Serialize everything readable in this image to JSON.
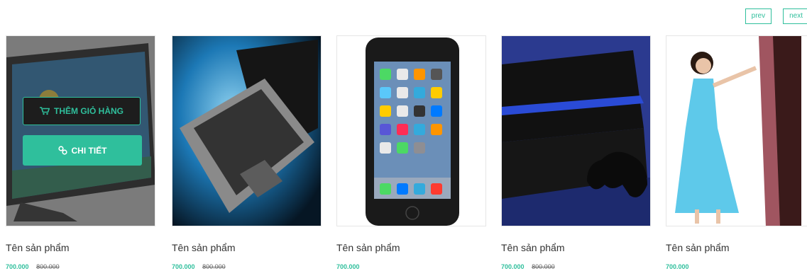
{
  "pagination": {
    "prev_label": "prev",
    "next_label": "next"
  },
  "colors": {
    "accent": "#2fbf9c",
    "text": "#333333",
    "old_price": "#666666"
  },
  "overlay": {
    "add_to_cart_label": "THÊM GIỎ HÀNG",
    "detail_label": "CHI TIẾT",
    "cart_icon": "cart-icon",
    "link_icon": "link-icon"
  },
  "products": [
    {
      "name": "Tên sản phẩm",
      "price": "700.000",
      "old_price": "800.000",
      "image": "tv"
    },
    {
      "name": "Tên sản phẩm",
      "price": "700.000",
      "old_price": "800.000",
      "image": "laptop"
    },
    {
      "name": "Tên sản phẩm",
      "price": "700.000",
      "old_price": "",
      "image": "phone"
    },
    {
      "name": "Tên sản phẩm",
      "price": "700.000",
      "old_price": "800.000",
      "image": "console"
    },
    {
      "name": "Tên sản phẩm",
      "price": "700.000",
      "old_price": "",
      "image": "model"
    }
  ]
}
